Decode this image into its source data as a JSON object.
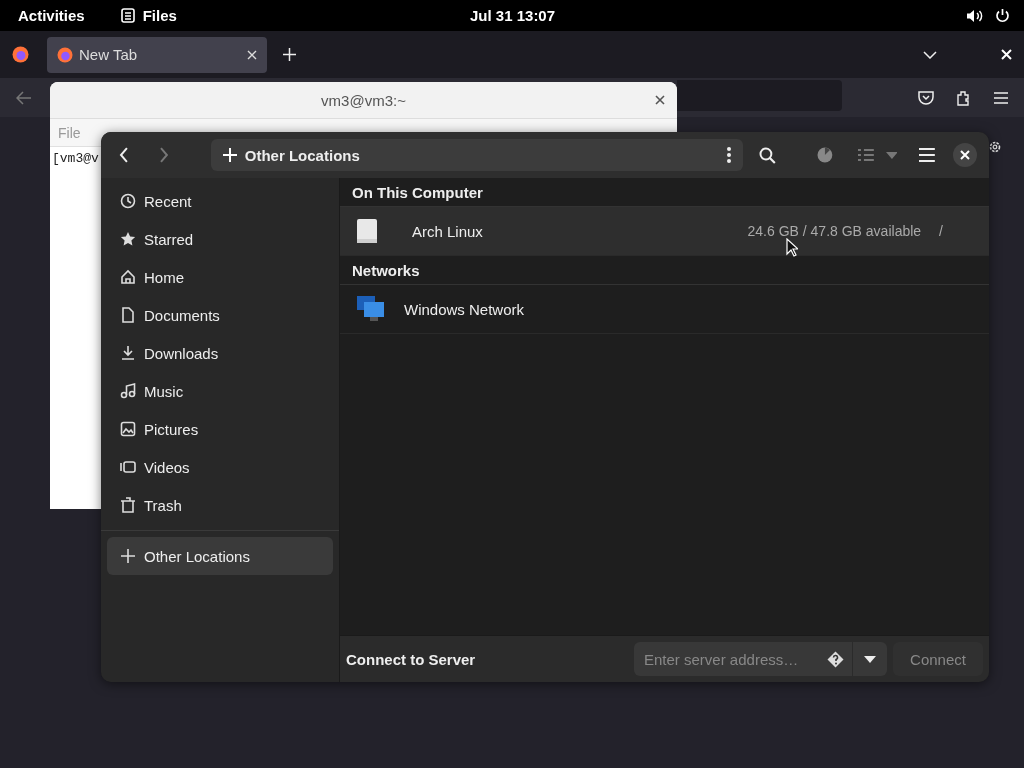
{
  "top_bar": {
    "activities": "Activities",
    "app": "Files",
    "clock": "Jul 31  13:07"
  },
  "browser": {
    "tabs": [
      {
        "label": "New Tab",
        "selected": true
      }
    ]
  },
  "terminal": {
    "title": "vm3@vm3:~",
    "menu": [
      "File"
    ],
    "prompt": "[vm3@v"
  },
  "files": {
    "path": "Other Locations",
    "sidebar": {
      "places": [
        {
          "label": "Recent",
          "selected": false
        },
        {
          "label": "Starred",
          "selected": false
        },
        {
          "label": "Home",
          "selected": false
        },
        {
          "label": "Documents",
          "selected": false
        },
        {
          "label": "Downloads",
          "selected": false
        },
        {
          "label": "Music",
          "selected": false
        },
        {
          "label": "Pictures",
          "selected": false
        },
        {
          "label": "Videos",
          "selected": false
        },
        {
          "label": "Trash",
          "selected": false
        }
      ],
      "other": [
        {
          "label": "Other Locations",
          "selected": true
        }
      ]
    },
    "sections": [
      {
        "title": "On This Computer",
        "items": [
          {
            "kind": "drive",
            "name": "Arch Linux",
            "info": "24.6 GB / 47.8 GB available",
            "mount": "/",
            "hovered": true
          }
        ]
      },
      {
        "title": "Networks",
        "items": [
          {
            "kind": "network",
            "name": "Windows Network",
            "hovered": false
          }
        ]
      }
    ],
    "connect": {
      "label": "Connect to Server",
      "placeholder": "Enter server address…",
      "button": "Connect",
      "button_disabled": true
    }
  }
}
